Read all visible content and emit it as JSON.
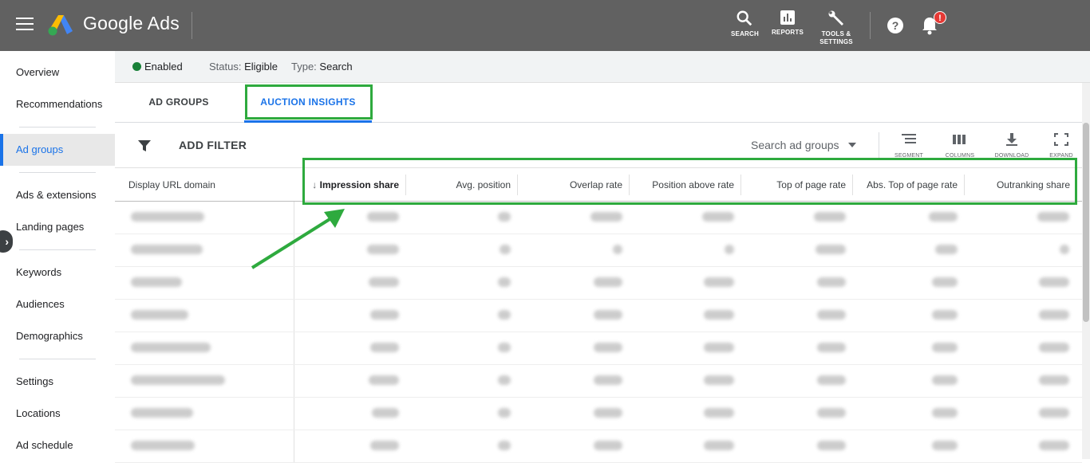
{
  "app": {
    "name": "Google Ads"
  },
  "header_tools": {
    "search": "SEARCH",
    "reports": "REPORTS",
    "tools": "TOOLS & SETTINGS",
    "notification_badge": "!"
  },
  "sidebar": {
    "items": [
      "Overview",
      "Recommendations",
      "Ad groups",
      "Ads & extensions",
      "Landing pages",
      "Keywords",
      "Audiences",
      "Demographics",
      "Settings",
      "Locations",
      "Ad schedule"
    ],
    "active": "Ad groups"
  },
  "status": {
    "enabled": "Enabled",
    "status_key": "Status:",
    "status_val": "Eligible",
    "type_key": "Type:",
    "type_val": "Search"
  },
  "tabs": [
    "AD GROUPS",
    "AUCTION INSIGHTS"
  ],
  "active_tab": "AUCTION INSIGHTS",
  "toolbar": {
    "add_filter": "ADD FILTER",
    "search_placeholder": "Search ad groups",
    "segment": "SEGMENT",
    "columns": "COLUMNS",
    "download": "DOWNLOAD",
    "expand": "EXPAND"
  },
  "table": {
    "columns": [
      "Display URL domain",
      "Impression share",
      "Avg. position",
      "Overlap rate",
      "Position above rate",
      "Top of page rate",
      "Abs. Top of page rate",
      "Outranking share"
    ],
    "sorted_column": "Impression share",
    "row_count": 8
  },
  "colors": {
    "accent": "#1a73e8",
    "highlight": "#2eaa3e",
    "enabled": "#188038",
    "topbar": "#616161"
  }
}
